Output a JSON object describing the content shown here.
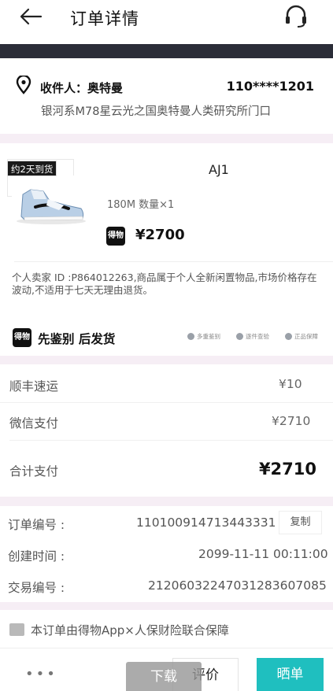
{
  "header": {
    "title": "订单详情",
    "back_icon": "arrow-left-icon",
    "support_icon": "headset-icon"
  },
  "address": {
    "receiver_label": "收件人：奥特曼",
    "phone": "110****1201",
    "address": "银河系M78星云光之国奥特曼人类研究所门口"
  },
  "product": {
    "delivery_tag": "约2天到货",
    "name": "AJ1",
    "spec": "180M 数量×1",
    "price": "¥2700",
    "logo_text": "得物",
    "note": "个人卖家 ID :P864012263,商品属于个人全新闲置物品,市场价格存在波动,不适用于七天无理由退货。",
    "verify_title": "先鉴别 后发货",
    "badges": [
      "多重鉴别",
      "逐件查验",
      "正品保障"
    ]
  },
  "payment": {
    "shipping_label": "顺丰速运",
    "shipping_value": "¥10",
    "wechat_label": "微信支付",
    "wechat_value": "¥2710",
    "total_label": "合计支付",
    "total_value": "¥2710"
  },
  "order_info": {
    "order_no_label": "订单编号 :",
    "order_no": "110100914713443331",
    "copy_label": "复制",
    "created_label": "创建时间 :",
    "created": "2099-11-11 00:11:00",
    "trade_no_label": "交易编号 :",
    "trade_no": "2120603224703128360708​5"
  },
  "insurance": {
    "text": "本订单由得物App×人保财险联合保障"
  },
  "bottom_bar": {
    "more_label": "•••",
    "download_label": "下载",
    "evaluate_label": "评价",
    "show_label": "晒单"
  },
  "colors": {
    "accent": "#1fbfbf",
    "dark_bar": "#2b2d38",
    "separator": "#f6eef5"
  }
}
